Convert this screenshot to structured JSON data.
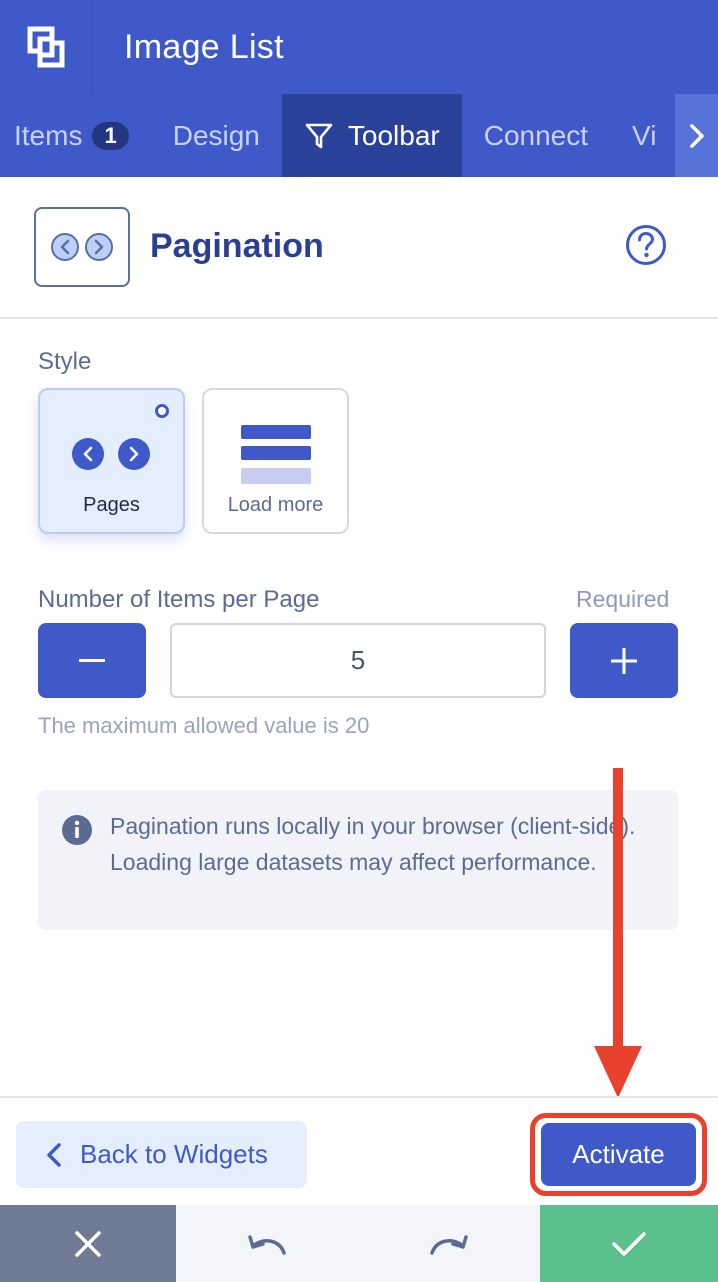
{
  "header": {
    "title": "Image List",
    "logo_icon": "brand-logo-icon"
  },
  "tabs": [
    {
      "label": "Items",
      "badge": "1",
      "active": false
    },
    {
      "label": "Design",
      "active": false
    },
    {
      "label": "Toolbar",
      "icon": "filter-icon",
      "active": true
    },
    {
      "label": "Connect",
      "active": false
    },
    {
      "label": "Vi",
      "active": false
    }
  ],
  "widget": {
    "title": "Pagination",
    "icon": "pagination-icon",
    "help_icon": "question-icon"
  },
  "style_section": {
    "label": "Style",
    "options": [
      {
        "label": "Pages",
        "selected": true
      },
      {
        "label": "Load more",
        "selected": false
      }
    ]
  },
  "items_per_page": {
    "label": "Number of Items per Page",
    "required_label": "Required",
    "value": "5",
    "hint": "The maximum allowed value is 20"
  },
  "info": {
    "text": "Pagination runs locally in your browser (client-side). Loading large datasets may affect performance."
  },
  "footer": {
    "back_label": "Back to Widgets",
    "activate_label": "Activate"
  },
  "colors": {
    "primary": "#3f5ac8",
    "annotation": "#e8412e",
    "confirm": "#5cc08d",
    "cancel": "#6f7b92"
  }
}
